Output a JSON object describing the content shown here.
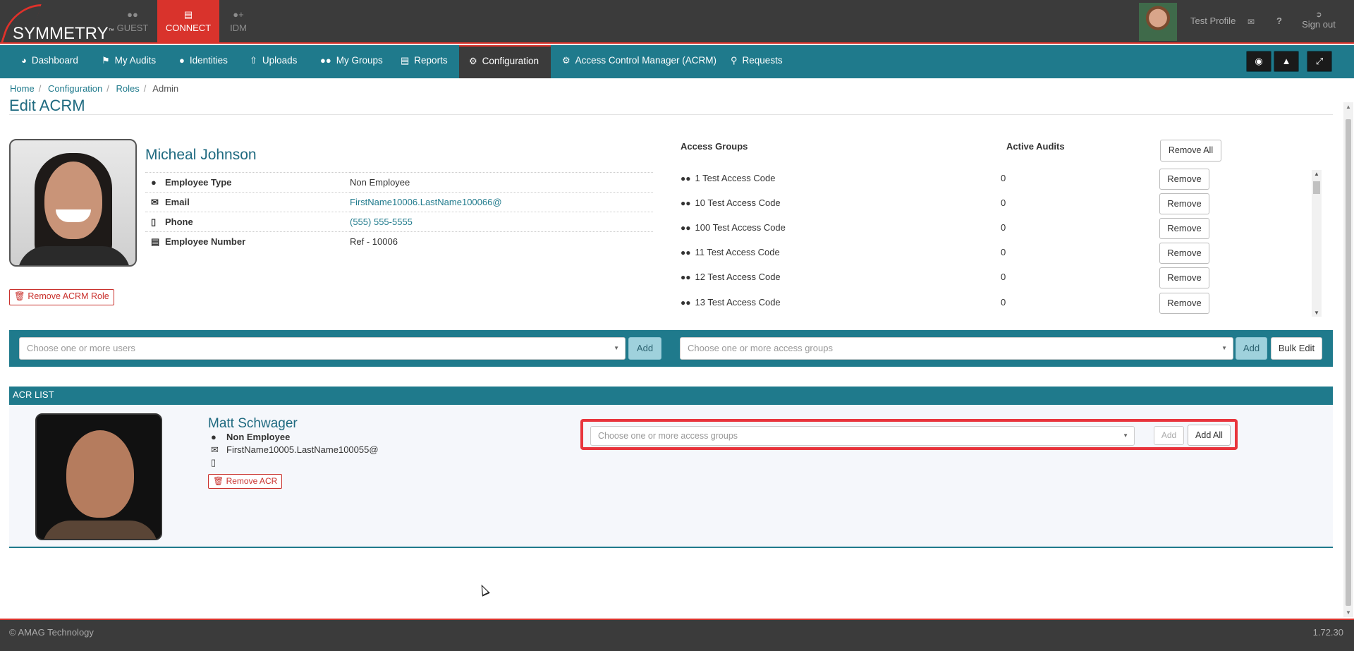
{
  "brand": {
    "name": "SYMMETRY",
    "tm": "™"
  },
  "app_tabs": [
    {
      "label": "GUEST",
      "icon": "guest-icon"
    },
    {
      "label": "CONNECT",
      "icon": "connect-card-icon"
    },
    {
      "label": "IDM",
      "icon": "idm-user-icon"
    }
  ],
  "user": {
    "profile_label": "Test Profile",
    "signout_label": "Sign out",
    "help": "?"
  },
  "nav": {
    "items": [
      {
        "label": "Dashboard",
        "icon": "dashboard-icon"
      },
      {
        "label": "My Audits",
        "icon": "flag-icon"
      },
      {
        "label": "Identities",
        "icon": "user-icon"
      },
      {
        "label": "Uploads",
        "icon": "upload-icon"
      },
      {
        "label": "My Groups",
        "icon": "group-icon"
      },
      {
        "label": "Reports",
        "icon": "chart-icon"
      },
      {
        "label": "Configuration",
        "icon": "gear-icon"
      },
      {
        "label": "Access Control Manager (ACRM)",
        "icon": "gear-icon"
      },
      {
        "label": "Requests",
        "icon": "key-icon"
      }
    ],
    "active_index": 6
  },
  "breadcrumb": [
    "Home",
    "Configuration",
    "Roles",
    "Admin"
  ],
  "page_title": "Edit ACRM",
  "person": {
    "name": "Micheal Johnson",
    "fields": [
      {
        "key": "Employee Type",
        "value": "Non Employee",
        "icon": "user-icon"
      },
      {
        "key": "Email",
        "value": "FirstName10006.LastName100066@",
        "icon": "envelope-icon"
      },
      {
        "key": "Phone",
        "value": "(555) 555-5555",
        "icon": "mobile-icon"
      },
      {
        "key": "Employee Number",
        "value": "Ref - 10006",
        "icon": "id-card-icon"
      }
    ],
    "remove_role_label": "Remove ACRM Role"
  },
  "access_groups": {
    "header_name": "Access Groups",
    "header_active": "Active Audits",
    "remove_all_label": "Remove All",
    "remove_label": "Remove",
    "rows": [
      {
        "name": "1 Test Access Code",
        "active": "0"
      },
      {
        "name": "10 Test Access Code",
        "active": "0"
      },
      {
        "name": "100 Test Access Code",
        "active": "0"
      },
      {
        "name": "11 Test Access Code",
        "active": "0"
      },
      {
        "name": "12 Test Access Code",
        "active": "0"
      },
      {
        "name": "13 Test Access Code",
        "active": "0"
      }
    ]
  },
  "action_bar": {
    "users_placeholder": "Choose one or more users",
    "groups_placeholder": "Choose one or more access groups",
    "add_label": "Add",
    "bulk_edit_label": "Bulk Edit"
  },
  "acr_list": {
    "header": "ACR LIST",
    "entry": {
      "name": "Matt Schwager",
      "type": "Non Employee",
      "email": "FirstName10005.LastName100055@",
      "phone": "",
      "remove_label": "Remove ACR",
      "groups_placeholder": "Choose one or more access groups",
      "add_label": "Add",
      "add_all_label": "Add All"
    }
  },
  "footer": {
    "copyright": "© AMAG Technology",
    "version": "1.72.30"
  },
  "colors": {
    "accent": "#1f7a8c",
    "brand_red": "#d9332c",
    "dark": "#3b3b3b",
    "highlight": "#e8343c"
  }
}
